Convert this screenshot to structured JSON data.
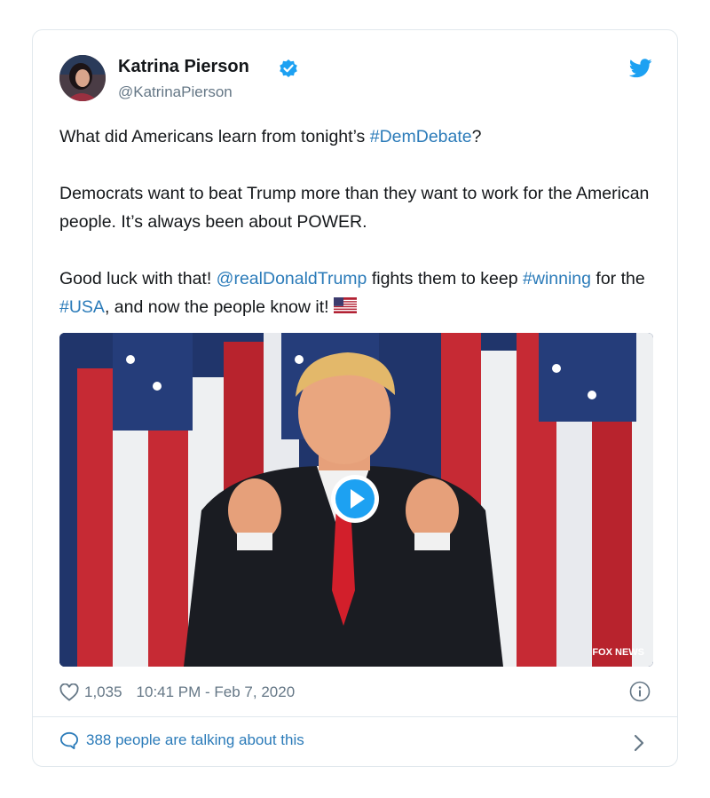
{
  "tweet": {
    "author_name": "Katrina Pierson",
    "author_handle": "@KatrinaPierson",
    "paragraphs": [
      [
        {
          "t": "What did Americans learn from tonight’s ",
          "link": false
        },
        {
          "t": "#DemDebate",
          "link": true
        },
        {
          "t": "?",
          "link": false
        }
      ],
      [
        {
          "t": "Democrats want to beat Trump more than they want to work for the American people. It’s always been about POWER.",
          "link": false
        }
      ],
      [
        {
          "t": "Good luck with that! ",
          "link": false
        },
        {
          "t": "@realDonaldTrump",
          "link": true
        },
        {
          "t": " fights them to keep ",
          "link": false
        },
        {
          "t": "#winning",
          "link": true
        },
        {
          "t": " for the ",
          "link": false
        },
        {
          "t": "#USA",
          "link": true
        },
        {
          "t": ", and now the people know it! ",
          "link": false
        },
        {
          "t": "🇺🇸",
          "link": false,
          "flag": true
        }
      ]
    ],
    "like_count": "1,035",
    "timestamp": "10:41 PM - Feb 7, 2020",
    "talking_text": "388 people are talking about this",
    "media_watermark": "FOX NEWS"
  },
  "colors": {
    "link": "#2b7bb9",
    "muted": "#657786",
    "twitter_blue": "#1da1f2"
  },
  "icons": {
    "verified": "verified-badge-icon",
    "bird": "twitter-bird-icon",
    "play": "play-icon",
    "heart": "heart-icon",
    "info": "info-icon",
    "reply": "speech-bubble-icon",
    "chevron": "chevron-right-icon"
  }
}
